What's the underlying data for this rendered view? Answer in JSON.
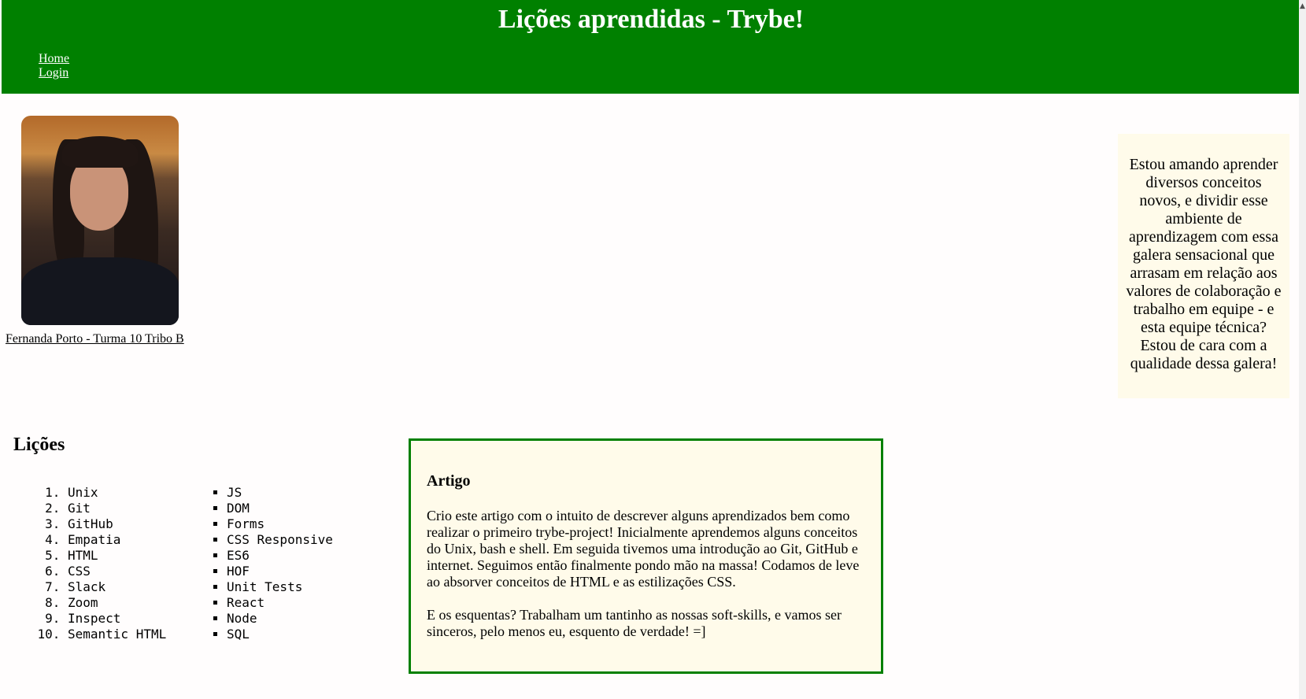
{
  "header": {
    "title": "Lições aprendidas - Trybe!",
    "nav": [
      {
        "label": "Home"
      },
      {
        "label": "Login"
      }
    ]
  },
  "profile": {
    "caption": "Fernanda Porto - Turma 10 Tribo B"
  },
  "aside": {
    "text": "Estou amando aprender diversos conceitos novos, e dividir esse ambiente de aprendizagem com essa galera sensacional que arrasam em relação aos valores de colaboração e trabalho em equipe - e esta equipe técnica? Estou de cara com a qualidade dessa galera!"
  },
  "licoes": {
    "title": "Lições",
    "ordered": [
      "Unix",
      "Git",
      "GitHub",
      "Empatia",
      "HTML",
      "CSS",
      "Slack",
      "Zoom",
      "Inspect",
      "Semantic HTML"
    ],
    "unordered": [
      "JS",
      "DOM",
      "Forms",
      "CSS Responsive",
      "ES6",
      "HOF",
      "Unit Tests",
      "React",
      "Node",
      "SQL"
    ]
  },
  "artigo": {
    "title": "Artigo",
    "paragraph1": "Crio este artigo com o intuito de descrever alguns aprendizados bem como realizar o primeiro trybe-project! Inicialmente aprendemos alguns conceitos do Unix, bash e shell. Em seguida tivemos uma introdução ao Git, GitHub e internet. Seguimos então finalmente pondo mão na massa! Codamos de leve ao absorver conceitos de HTML e as estilizações CSS.",
    "paragraph2": "E os esquentas? Trabalham um tantinho as nossas soft-skills, e vamos ser sinceros, pelo menos eu, esquento de verdade! =]"
  },
  "colors": {
    "header_bg": "#008000",
    "article_bg": "#fffbea",
    "article_border": "#008000"
  }
}
